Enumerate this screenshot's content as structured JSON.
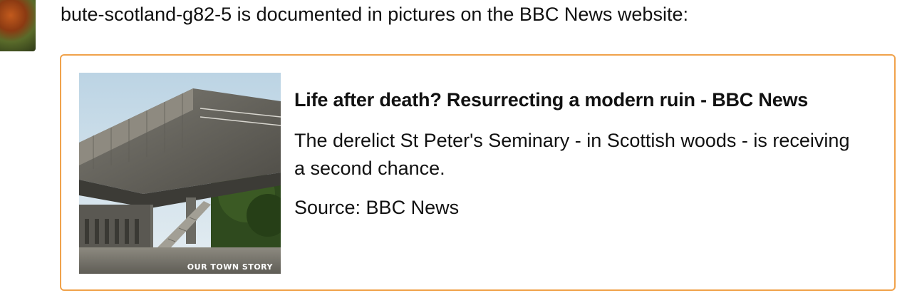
{
  "post": {
    "intro_text": "bute-scotland-g82-5 is documented in pictures on the BBC News website:"
  },
  "link_card": {
    "title": "Life after death? Resurrecting a modern ruin - BBC News",
    "description": "The derelict St Peter's Seminary - in Scottish woods - is receiving a second chance.",
    "source": "Source: BBC News",
    "image_caption": "OUR TOWN STORY",
    "border_color": "#f0a24b"
  }
}
